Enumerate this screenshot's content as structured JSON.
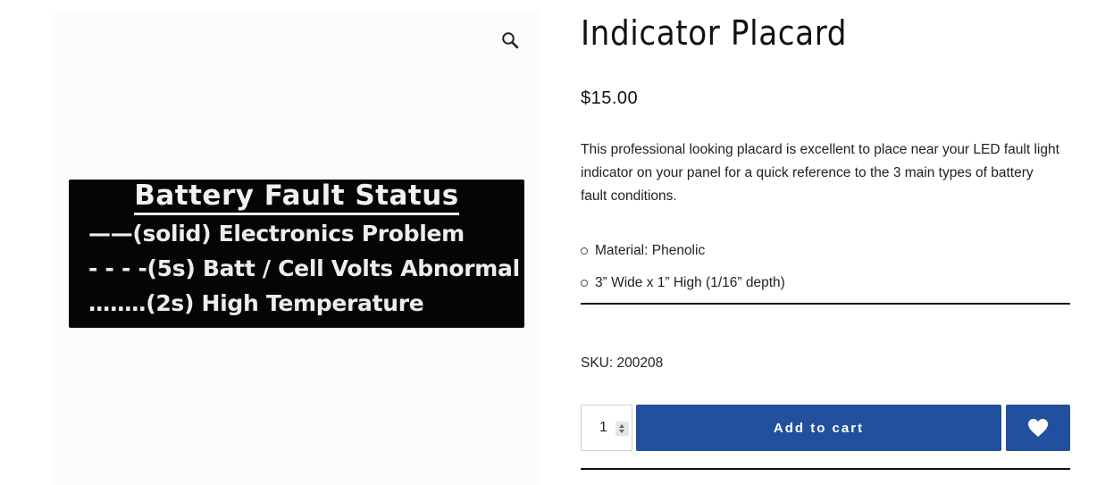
{
  "gallery": {
    "zoom_icon": "magnifier-icon",
    "placard": {
      "title": "Battery Fault Status",
      "lines": [
        "——(solid) Electronics Problem",
        "- - - -(5s) Batt / Cell Volts Abnormal",
        "․․․․․․․․(2s) High Temperature"
      ]
    }
  },
  "product": {
    "title": "Indicator Placard",
    "price": "$15.00",
    "description": "This professional looking placard is excellent to place near your LED fault light indicator on your panel for a quick reference to the 3 main types of battery fault conditions.",
    "features": [
      "Material: Phenolic",
      "3” Wide x 1” High (1/16” depth)"
    ],
    "sku": "SKU: 200208"
  },
  "cart": {
    "quantity": "1",
    "add_to_cart_label": "Add to cart",
    "wishlist_icon": "heart-icon",
    "button_color": "#22509e"
  }
}
